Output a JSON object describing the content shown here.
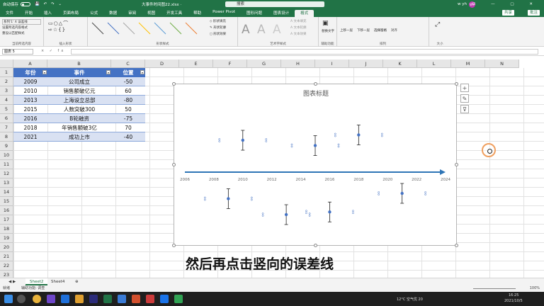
{
  "titlebar": {
    "autosave": "自动保存",
    "autosave_state": "关",
    "filename": "大事件时间图22.xlsx ·",
    "search": "搜索",
    "user": "w yh",
    "avatar": "WY"
  },
  "menu": {
    "tabs": [
      "文件",
      "开始",
      "插入",
      "页面布局",
      "公式",
      "数据",
      "审阅",
      "视图",
      "开发工具",
      "帮助",
      "Power Pivot",
      "图形问题",
      "图表设计",
      "格式"
    ],
    "active": "格式",
    "share": "共享",
    "comment": "批注"
  },
  "ribbon": {
    "current_selection": {
      "dropdown": "系列'1' X 误差线",
      "format_selection": "设置所选内容格式",
      "reset_style": "重设以匹配样式",
      "label": "当前所选内容"
    },
    "insert_shapes_label": "插入形状",
    "shape_styles_label": "形状样式",
    "shape_fill": "形状填充",
    "shape_outline": "形状轮廓",
    "shape_effects": "形状效果",
    "wordart_label": "艺术字样式",
    "text_fill": "文本填充",
    "text_outline": "文本轮廓",
    "text_effects": "文本效果",
    "alt_text": "替换文字",
    "accessibility_label": "辅助功能",
    "bring_forward": "上移一层",
    "send_backward": "下移一层",
    "selection_pane": "选择窗格",
    "align": "对齐",
    "arrange_label": "排列",
    "size_label": "大小"
  },
  "formula_bar": {
    "name_box": "图表 5",
    "fx": "× ✓ fx",
    "value": ""
  },
  "grid": {
    "columns": [
      "A",
      "B",
      "C",
      "D",
      "E",
      "F",
      "G",
      "H",
      "I",
      "J",
      "K",
      "L",
      "M",
      "N"
    ],
    "rows": [
      "1",
      "2",
      "3",
      "4",
      "5",
      "6",
      "7",
      "8",
      "9",
      "10",
      "11",
      "12",
      "13",
      "14",
      "15",
      "16",
      "17",
      "18",
      "19",
      "20",
      "21",
      "22",
      "23"
    ]
  },
  "table": {
    "headers": [
      "年份",
      "事件",
      "位置"
    ],
    "rows": [
      [
        "2009",
        "公司成立",
        "-50"
      ],
      [
        "2010",
        "销售额破亿元",
        "60"
      ],
      [
        "2013",
        "上海设立总部",
        "-80"
      ],
      [
        "2015",
        "人数突破300",
        "50"
      ],
      [
        "2016",
        "B轮融资",
        "-75"
      ],
      [
        "2018",
        "年销售额破3亿",
        "70"
      ],
      [
        "2021",
        "成功上市",
        "-40"
      ]
    ]
  },
  "chart_data": {
    "type": "scatter",
    "title": "图表标题",
    "x": [
      2009,
      2010,
      2013,
      2015,
      2016,
      2018,
      2021
    ],
    "y": [
      -50,
      60,
      -80,
      50,
      -75,
      70,
      -40
    ],
    "xlim": [
      2006,
      2024
    ],
    "xticks": [
      "2006",
      "2008",
      "2010",
      "2012",
      "2014",
      "2016",
      "2018",
      "2020",
      "2022",
      "2024"
    ],
    "ylim": [
      -120,
      120
    ],
    "xaxis_arrow": true,
    "error_bars": "vertical",
    "marker_color": "#4472c4",
    "axis_color": "#2e75b6"
  },
  "side_buttons": [
    "+",
    "✎",
    "⊽"
  ],
  "caption": "然后再点击竖向的误差线",
  "sheet_tabs": [
    "Sheet2",
    "Sheet4"
  ],
  "active_sheet": "Sheet2",
  "status": {
    "left": "就绪",
    "accessibility": "辅助功能: 调查",
    "zoom": "100%"
  },
  "taskbar": {
    "weather": "12°C 空气优 20",
    "time": "16:25",
    "date": "2021/10/5"
  }
}
